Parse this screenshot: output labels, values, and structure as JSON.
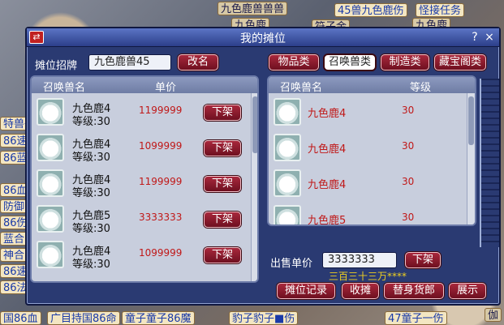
{
  "background": {
    "tags": [
      {
        "text": "九色鹿兽兽兽",
        "style": "dark"
      },
      {
        "text": "45兽九色鹿伤",
        "style": "blue"
      },
      {
        "text": "怪接任务",
        "style": "blue"
      },
      {
        "text": "九色鹿",
        "style": "dark"
      },
      {
        "text": "九色鹿伤",
        "style": "dark"
      },
      {
        "text": "符子金",
        "style": "dark"
      },
      {
        "text": "九色鹿",
        "style": "dark"
      },
      {
        "text": "特兽子",
        "style": "blue"
      },
      {
        "text": "86速",
        "style": "blue"
      },
      {
        "text": "86蓝",
        "style": "blue"
      },
      {
        "text": "86血",
        "style": "blue"
      },
      {
        "text": "防御",
        "style": "blue"
      },
      {
        "text": "86伤",
        "style": "blue"
      },
      {
        "text": "蓝合",
        "style": "blue"
      },
      {
        "text": "神合",
        "style": "blue"
      },
      {
        "text": "86速",
        "style": "blue"
      },
      {
        "text": "86法",
        "style": "blue"
      },
      {
        "text": "国86血",
        "style": "blue"
      },
      {
        "text": "广目持国86命",
        "style": "blue"
      },
      {
        "text": "童子童子86魔",
        "style": "blue"
      },
      {
        "text": "豹子豹子■伤",
        "style": "blue"
      },
      {
        "text": "47童子一伤",
        "style": "blue"
      },
      {
        "text": "伽",
        "style": "dark"
      }
    ]
  },
  "window": {
    "title": "我的摊位",
    "swap_icon": "⇄",
    "help": "?",
    "close": "×"
  },
  "stall": {
    "sign_label": "摊位招牌",
    "sign_value": "九色鹿兽45",
    "rename_button": "改名"
  },
  "categories": [
    {
      "label": "物品类",
      "active": false
    },
    {
      "label": "召唤兽类",
      "active": true
    },
    {
      "label": "制造类",
      "active": false
    },
    {
      "label": "藏宝阁类",
      "active": false
    }
  ],
  "listing": {
    "col_name": "召唤兽名",
    "col_price": "单价",
    "rows": [
      {
        "name": "九色鹿4",
        "level": "等级:30",
        "price": "1199999",
        "action": "下架"
      },
      {
        "name": "九色鹿4",
        "level": "等级:30",
        "price": "1099999",
        "action": "下架"
      },
      {
        "name": "九色鹿4",
        "level": "等级:30",
        "price": "1199999",
        "action": "下架"
      },
      {
        "name": "九色鹿5",
        "level": "等级:30",
        "price": "3333333",
        "action": "下架"
      },
      {
        "name": "九色鹿4",
        "level": "等级:30",
        "price": "1099999",
        "action": "下架"
      }
    ]
  },
  "inventory": {
    "col_name": "召唤兽名",
    "col_level": "等级",
    "rows": [
      {
        "name": "九色鹿4",
        "level": "30"
      },
      {
        "name": "九色鹿4",
        "level": "30"
      },
      {
        "name": "九色鹿4",
        "level": "30"
      },
      {
        "name": "九色鹿5",
        "level": "30"
      }
    ]
  },
  "sell": {
    "label": "出售单价",
    "value": "3333333",
    "list_button": "下架",
    "hint": "三百三十三万****"
  },
  "footer_buttons": [
    "摊位记录",
    "收摊",
    "替身货郎",
    "展示"
  ],
  "colors": {
    "accent_red": "#c01818",
    "window_blue": "#2a3a72"
  }
}
